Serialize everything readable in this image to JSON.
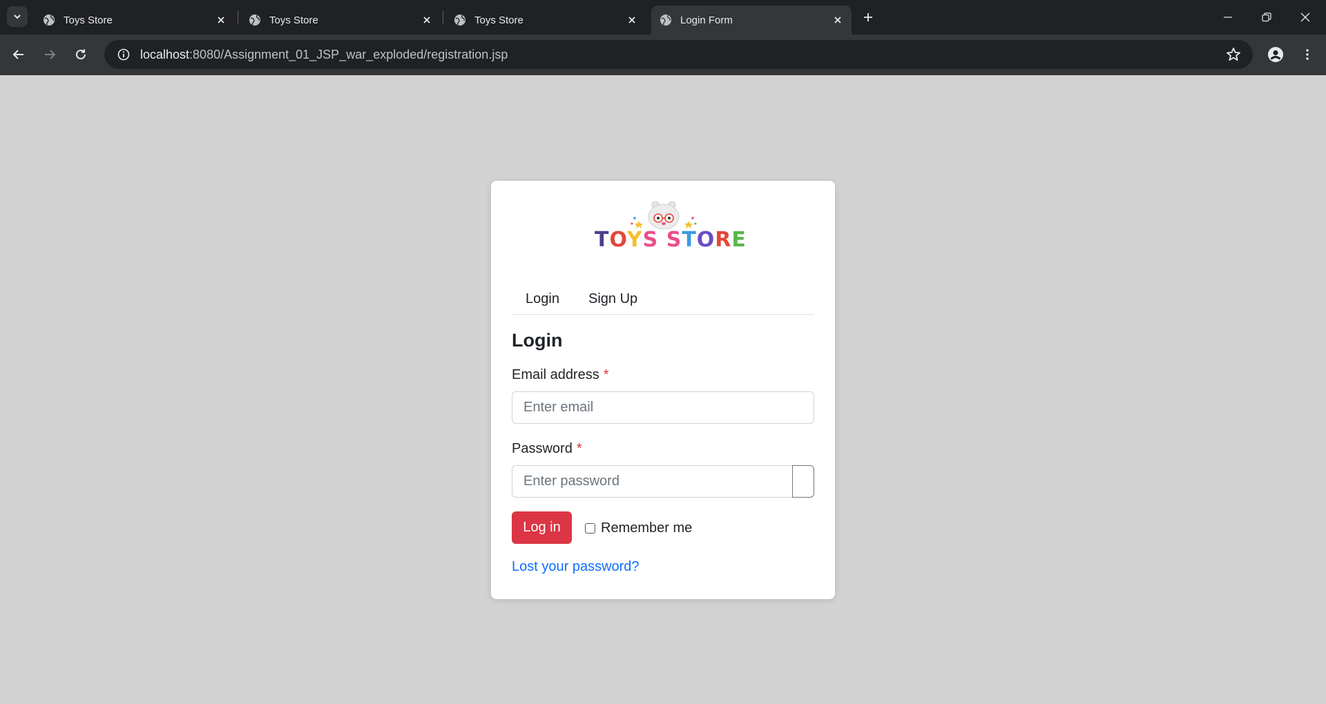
{
  "browser": {
    "tabs": [
      {
        "title": "Toys Store",
        "active": false
      },
      {
        "title": "Toys Store",
        "active": false
      },
      {
        "title": "Toys Store",
        "active": false
      },
      {
        "title": "Login Form",
        "active": true
      }
    ],
    "url_host": "localhost",
    "url_path": ":8080/Assignment_01_JSP_war_exploded/registration.jsp"
  },
  "logo": {
    "text": "TOYS STORE",
    "letter_colors": [
      "#4b3f8f",
      "#e2483a",
      "#f2c12e",
      "#e94f8a",
      "#ffffff",
      "#e94f8a",
      "#3b9be0",
      "#6b4cc4",
      "#e2483a",
      "#59b64a"
    ]
  },
  "nav": {
    "login": "Login",
    "signup": "Sign Up"
  },
  "form": {
    "heading": "Login",
    "email_label": "Email address",
    "email_placeholder": "Enter email",
    "password_label": "Password",
    "password_placeholder": "Enter password",
    "required_mark": "*",
    "submit": "Log in",
    "remember": "Remember me",
    "lost_password": "Lost your password?"
  },
  "colors": {
    "primary_button": "#dc3545",
    "link": "#0d6efd",
    "page_background": "#d3d3d3"
  }
}
